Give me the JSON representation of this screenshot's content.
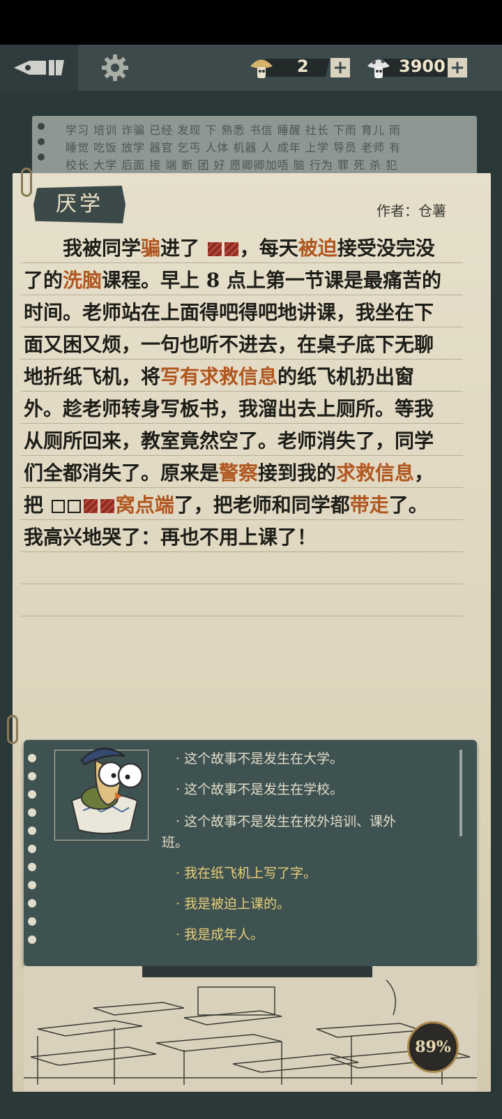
{
  "topbar": {
    "currency_tokens": "2",
    "currency_coins": "3900",
    "plus": "+"
  },
  "background_words": [
    "学习 培训 诈骗 已经 发现 下 熟悉 书信 睡醒 社长 下雨 育儿 雨",
    "睡觉 吃饭 放学 器官 乞丐 人体 机器 人 成年 上学 导员 老师 有",
    "校长 大学 后面 接 端 断 团 好 愿卿卿加唔 脑 行为 罪 死 杀 犯"
  ],
  "story": {
    "title": "厌学",
    "author": "作者：仓薯",
    "lines": [
      [
        "我被同学",
        {
          "hl": "骗"
        },
        "进了 ",
        {
          "blk": 2
        },
        "，每天",
        {
          "hl": "被迫"
        },
        "接受没完没"
      ],
      [
        "了的",
        {
          "hl": "洗脑"
        },
        "课程。早上 8 点上第一节课是最痛苦的"
      ],
      [
        "时间。老师站在上面得吧得吧地讲课，我坐在下"
      ],
      [
        "面又困又烦，一句也听不进去，在桌子底下无聊"
      ],
      [
        "地折纸飞机，将",
        {
          "hl": "写有求救信息"
        },
        "的纸飞机扔出窗"
      ],
      [
        "外。趁老师转身写板书，我溜出去上厕所。等我"
      ],
      [
        "从厕所回来，教室竟然空了。老师消失了，同学"
      ],
      [
        "们全都消失了。原来是",
        {
          "hl": "警察"
        },
        "接到我的",
        {
          "hl": "求救信息"
        },
        "，"
      ],
      [
        "把 ",
        {
          "box": 2
        },
        {
          "blk": 2
        },
        {
          "hl": "窝点端"
        },
        "了，把老师和同学都",
        {
          "hl": "带走"
        },
        "了。"
      ],
      [
        "我高兴地哭了：再也不用上课了！"
      ]
    ]
  },
  "hints": [
    {
      "text": "· 这个故事不是发生在大学。",
      "highlight": false
    },
    {
      "text": "· 这个故事不是发生在学校。",
      "highlight": false
    },
    {
      "text": "· 这个故事不是发生在校外培训、课外",
      "highlight": false
    },
    {
      "text": "班。",
      "highlight": false
    },
    {
      "text": "· 我在纸飞机上写了字。",
      "highlight": true
    },
    {
      "text": "· 我是被迫上课的。",
      "highlight": true
    },
    {
      "text": "· 我是成年人。",
      "highlight": true
    }
  ],
  "progress": "89%",
  "colors": {
    "highlight": "#b0561f",
    "hint_highlight": "#e7cf78",
    "panel": "#3e5252"
  }
}
